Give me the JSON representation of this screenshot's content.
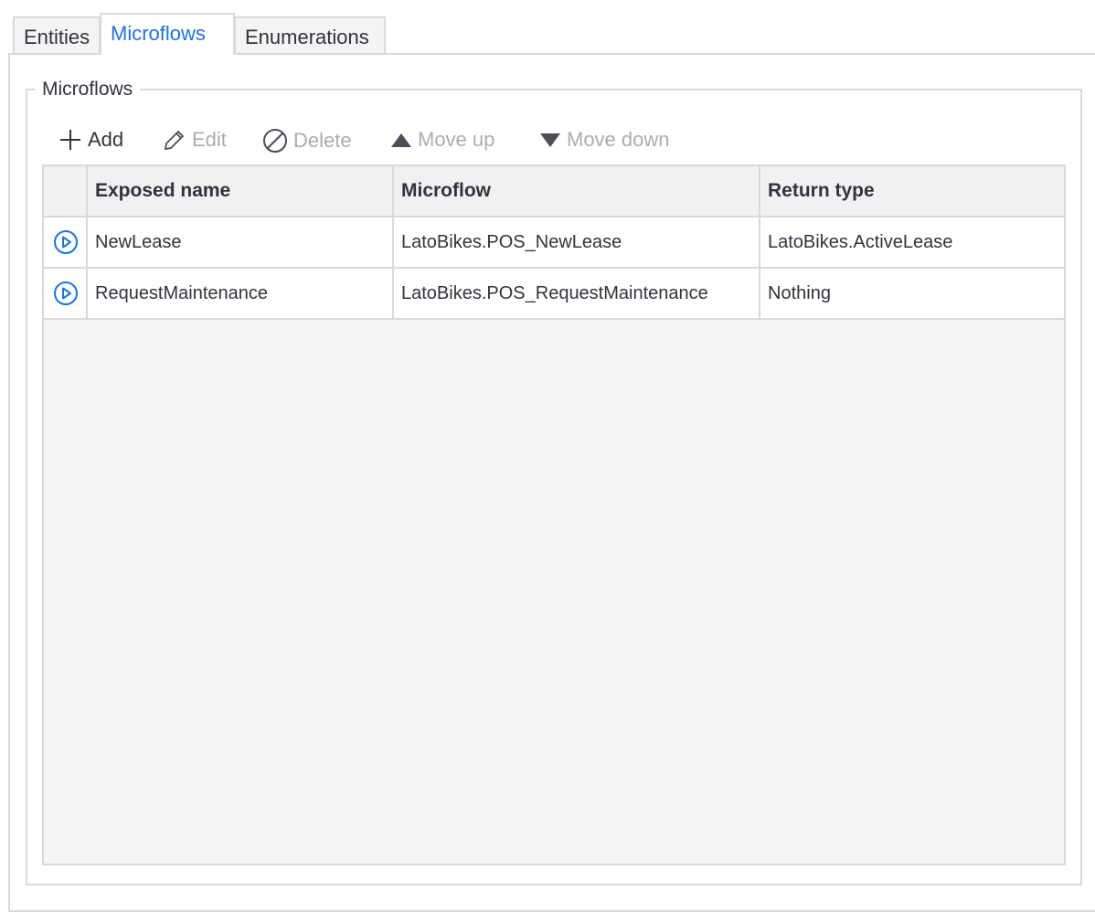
{
  "tabs": [
    {
      "label": "Entities"
    },
    {
      "label": "Microflows",
      "active": true
    },
    {
      "label": "Enumerations"
    }
  ],
  "group_title": "Microflows",
  "toolbar": {
    "add": "Add",
    "edit": "Edit",
    "delete": "Delete",
    "move_up": "Move up",
    "move_down": "Move down"
  },
  "table": {
    "headers": [
      "Exposed name",
      "Microflow",
      "Return type"
    ],
    "rows": [
      {
        "icon": "play-circle-icon",
        "exposed_name": "NewLease",
        "microflow": "LatoBikes.POS_NewLease",
        "return_type": "LatoBikes.ActiveLease"
      },
      {
        "icon": "play-circle-icon",
        "exposed_name": "RequestMaintenance",
        "microflow": "LatoBikes.POS_RequestMaintenance",
        "return_type": "Nothing"
      }
    ]
  },
  "colors": {
    "accent": "#1a73e8",
    "border": "#d9d9d9",
    "disabled": "#a9adb3"
  }
}
